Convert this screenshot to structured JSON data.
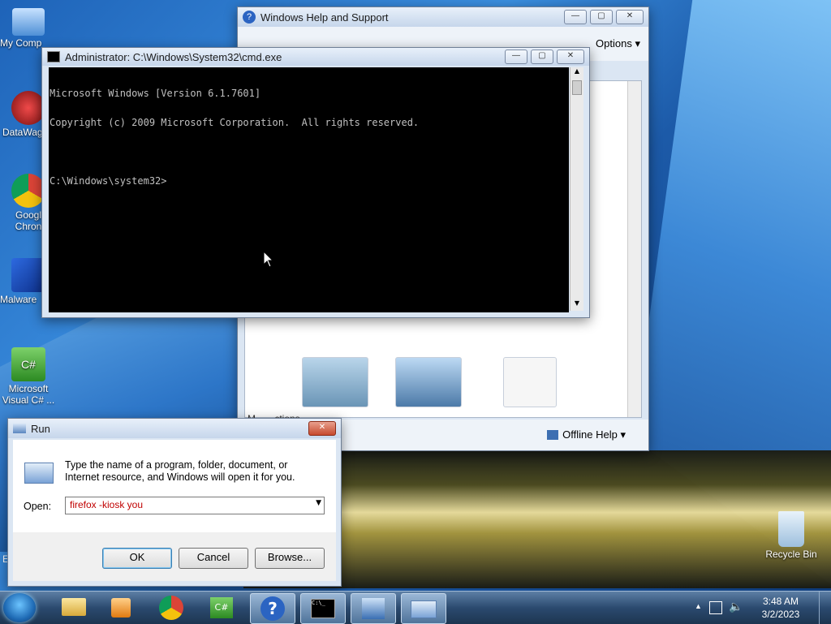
{
  "desktop": {
    "icons": [
      {
        "label": "My Comp"
      },
      {
        "label": "DataWag"
      },
      {
        "label": "Googl\nChron"
      },
      {
        "label": "Malware"
      },
      {
        "label": "Microsoft\nVisual C# ..."
      },
      {
        "label": "Recycle Bin"
      }
    ],
    "edge_letter": "E"
  },
  "help_window": {
    "title": "Windows Help and Support",
    "options_label": "Options",
    "offline_help_label": "Offline Help",
    "partial_text": "M...   ...ctions"
  },
  "cmd_window": {
    "title": "Administrator: C:\\Windows\\System32\\cmd.exe",
    "lines": [
      "Microsoft Windows [Version 6.1.7601]",
      "Copyright (c) 2009 Microsoft Corporation.  All rights reserved.",
      "",
      "C:\\Windows\\system32>"
    ]
  },
  "run_dialog": {
    "title": "Run",
    "description": "Type the name of a program, folder, document, or Internet resource, and Windows will open it for you.",
    "open_label": "Open:",
    "open_value": "firefox -kiosk you",
    "ok_label": "OK",
    "cancel_label": "Cancel",
    "browse_label": "Browse..."
  },
  "taskbar": {
    "time": "3:48 AM",
    "date": "3/2/2023",
    "cmd_icon_text": "C:\\_"
  },
  "colors": {
    "run_input_text": "#c00000",
    "console_bg": "#000000",
    "console_fg": "#c0c0c0"
  }
}
